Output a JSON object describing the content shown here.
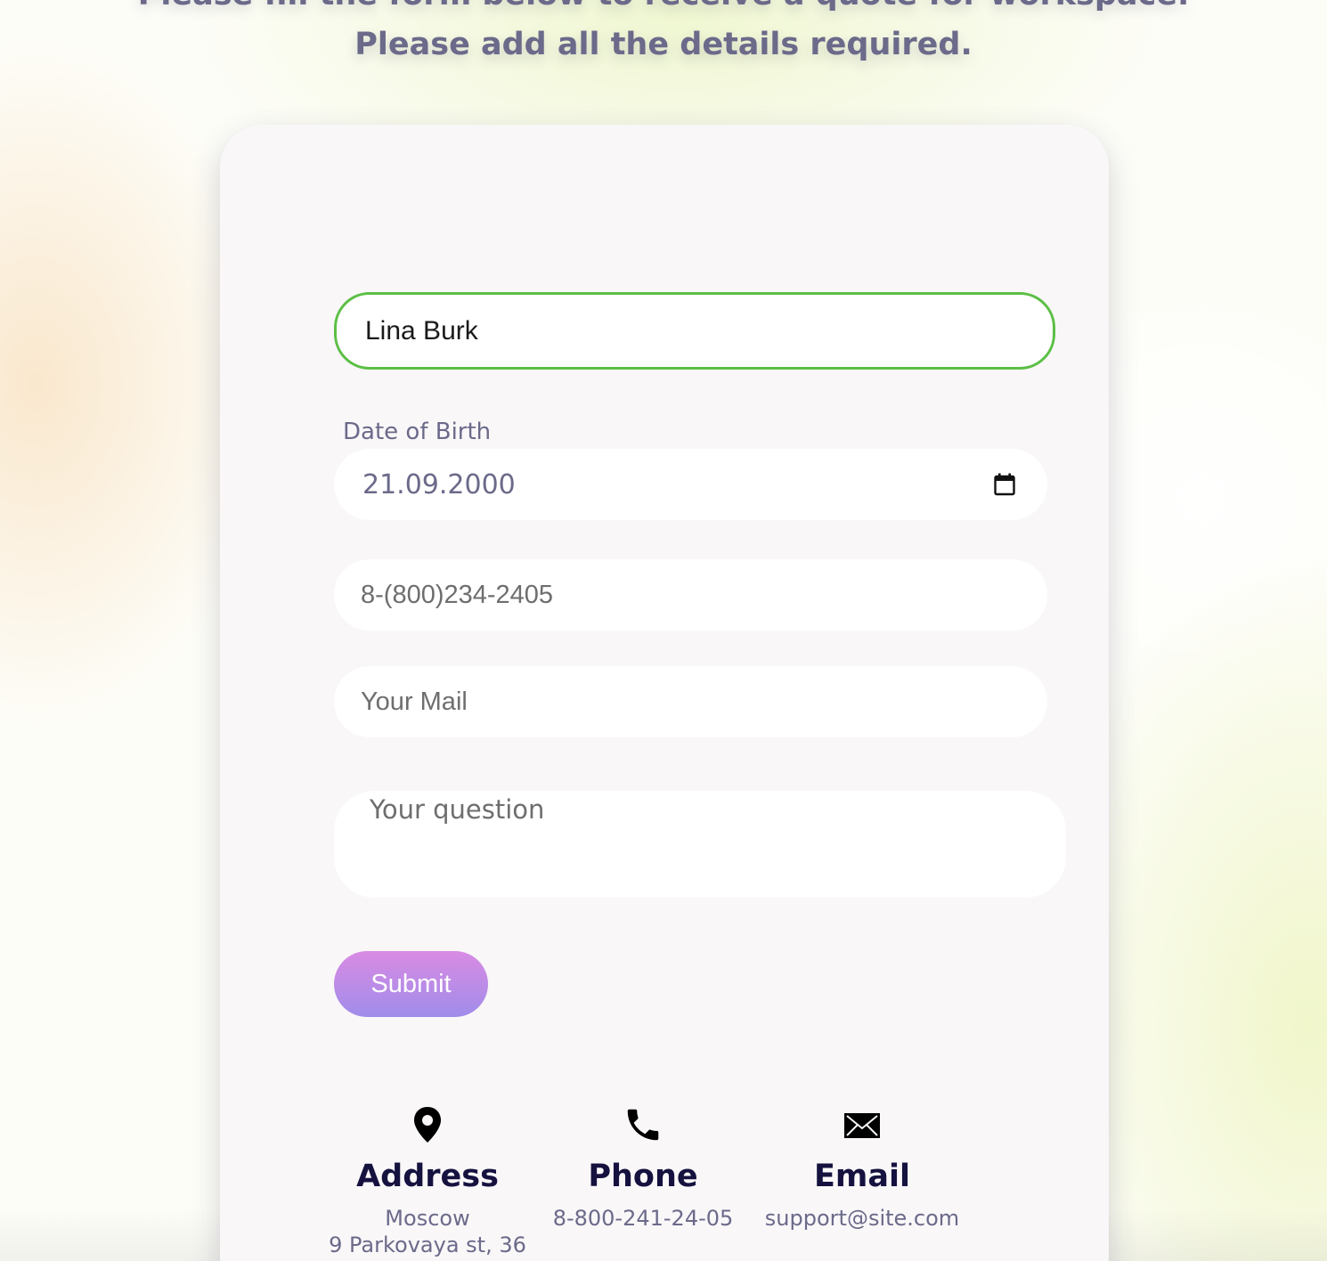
{
  "intro": {
    "line1": "Please fill the form below to receive a quote for workspace.",
    "line2": "Please add all the details required."
  },
  "form": {
    "name_value": "Lina Burk",
    "dob_label": "Date of Birth",
    "dob_value": "21.09.2000",
    "phone_placeholder": "8-(800)234-2405",
    "mail_placeholder": "Your Mail",
    "question_placeholder": "Your question",
    "submit_label": "Submit"
  },
  "contacts": {
    "address": {
      "title": "Address",
      "line1": "Moscow",
      "line2": "9 Parkovaya st, 36",
      "icon": "location-pin-icon"
    },
    "phone": {
      "title": "Phone",
      "line1": "8-800-241-24-05",
      "icon": "phone-icon"
    },
    "email": {
      "title": "Email",
      "line1": "support@site.com",
      "icon": "envelope-icon"
    }
  },
  "colors": {
    "focus_border": "#5cbf45",
    "heading_text": "#15123f",
    "muted_text": "#6b6a8a",
    "submit_gradient_top": "#d98be3",
    "submit_gradient_bottom": "#a08cea"
  }
}
